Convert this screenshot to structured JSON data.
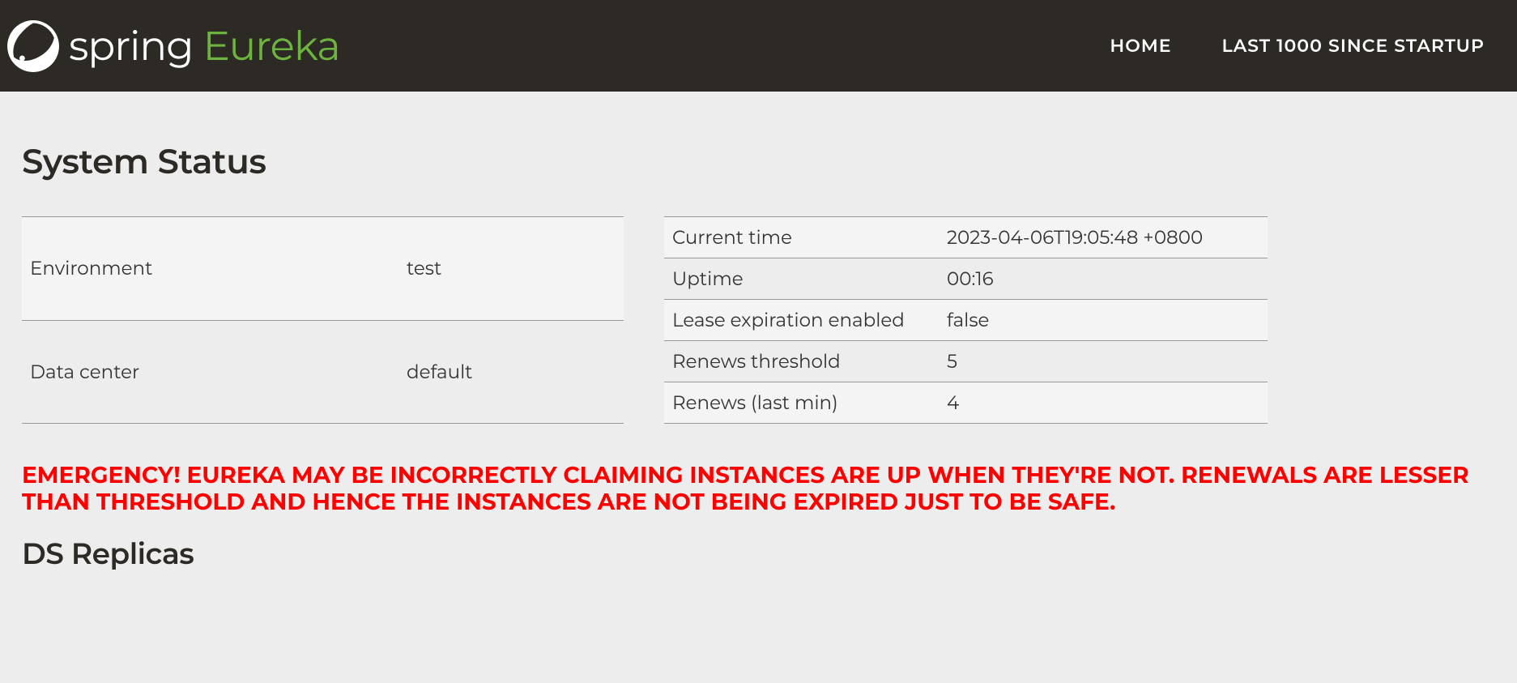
{
  "brand": {
    "part1": "spring",
    "part2": "Eureka"
  },
  "nav": {
    "home": "HOME",
    "last1000": "LAST 1000 SINCE STARTUP"
  },
  "headings": {
    "system_status": "System Status",
    "ds_replicas": "DS Replicas"
  },
  "status_left": [
    {
      "label": "Environment",
      "value": "test"
    },
    {
      "label": "Data center",
      "value": "default"
    }
  ],
  "status_right": [
    {
      "label": "Current time",
      "value": "2023-04-06T19:05:48 +0800"
    },
    {
      "label": "Uptime",
      "value": "00:16"
    },
    {
      "label": "Lease expiration enabled",
      "value": "false"
    },
    {
      "label": "Renews threshold",
      "value": "5"
    },
    {
      "label": "Renews (last min)",
      "value": "4"
    }
  ],
  "emergency_message": "EMERGENCY! EUREKA MAY BE INCORRECTLY CLAIMING INSTANCES ARE UP WHEN THEY'RE NOT. RENEWALS ARE LESSER THAN THRESHOLD AND HENCE THE INSTANCES ARE NOT BEING EXPIRED JUST TO BE SAFE."
}
